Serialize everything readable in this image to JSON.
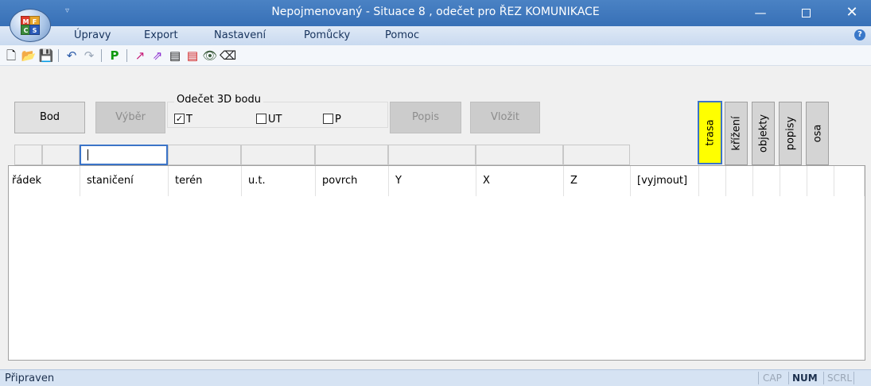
{
  "window": {
    "title": "Nepojmenovaný - Situace 8 , odečet pro ŘEZ KOMUNIKACE",
    "app_logo_letters": [
      "M",
      "F",
      "C",
      "S"
    ],
    "quick_access_glyph": "▿",
    "minimize": "—",
    "close": "✕"
  },
  "menu": {
    "items": [
      "Úpravy",
      "Export",
      "Nastavení",
      "Pomůcky",
      "Pomoc"
    ],
    "help_glyph": "?"
  },
  "toolbar": {
    "icons": [
      {
        "name": "new-file-icon",
        "glyph": "🗋",
        "color": "#000000"
      },
      {
        "name": "open-folder-icon",
        "glyph": "📂",
        "color": "#e2a400"
      },
      {
        "name": "save-icon",
        "glyph": "💾",
        "color": "#1a1a1a"
      },
      {
        "name": "undo-icon",
        "glyph": "↶",
        "color": "#2a5aa8"
      },
      {
        "name": "redo-icon",
        "glyph": "↷",
        "color": "#9aa7b8"
      },
      {
        "name": "p-green-icon",
        "glyph": "P",
        "color": "#109a10"
      },
      {
        "name": "route-tool-icon",
        "glyph": "↗",
        "color": "#c81e7a"
      },
      {
        "name": "route-tool-2-icon",
        "glyph": "⇗",
        "color": "#8a2bd0"
      },
      {
        "name": "document-icon",
        "glyph": "▤",
        "color": "#1a1a1a"
      },
      {
        "name": "document-red-icon",
        "glyph": "▤",
        "color": "#d01818"
      },
      {
        "name": "eye-icon",
        "glyph": "👁",
        "color": "#3a5a3a"
      },
      {
        "name": "eraser-icon",
        "glyph": "⌫",
        "color": "#1a1a1a"
      }
    ]
  },
  "controls": {
    "bod": "Bod",
    "vyber": "Výběr",
    "group_label": "Odečet 3D bodu",
    "chk_t": {
      "label": "T",
      "checked": true
    },
    "chk_ut": {
      "label": "UT",
      "checked": false
    },
    "chk_p": {
      "label": "P",
      "checked": false
    },
    "popis": "Popis",
    "vlozit": "Vložit"
  },
  "tabs": [
    "trasa",
    "křížení",
    "objekty",
    "popisy",
    "osa"
  ],
  "grid": {
    "headers": [
      "řádek",
      "staničení",
      "terén",
      "u.t.",
      "povrch",
      "Y",
      "X",
      "Z",
      "[vyjmout]",
      "",
      "",
      "",
      "",
      "",
      ""
    ]
  },
  "status": {
    "text": "Připraven",
    "cap": "CAP",
    "num": "NUM",
    "scrl": "SCRL"
  }
}
